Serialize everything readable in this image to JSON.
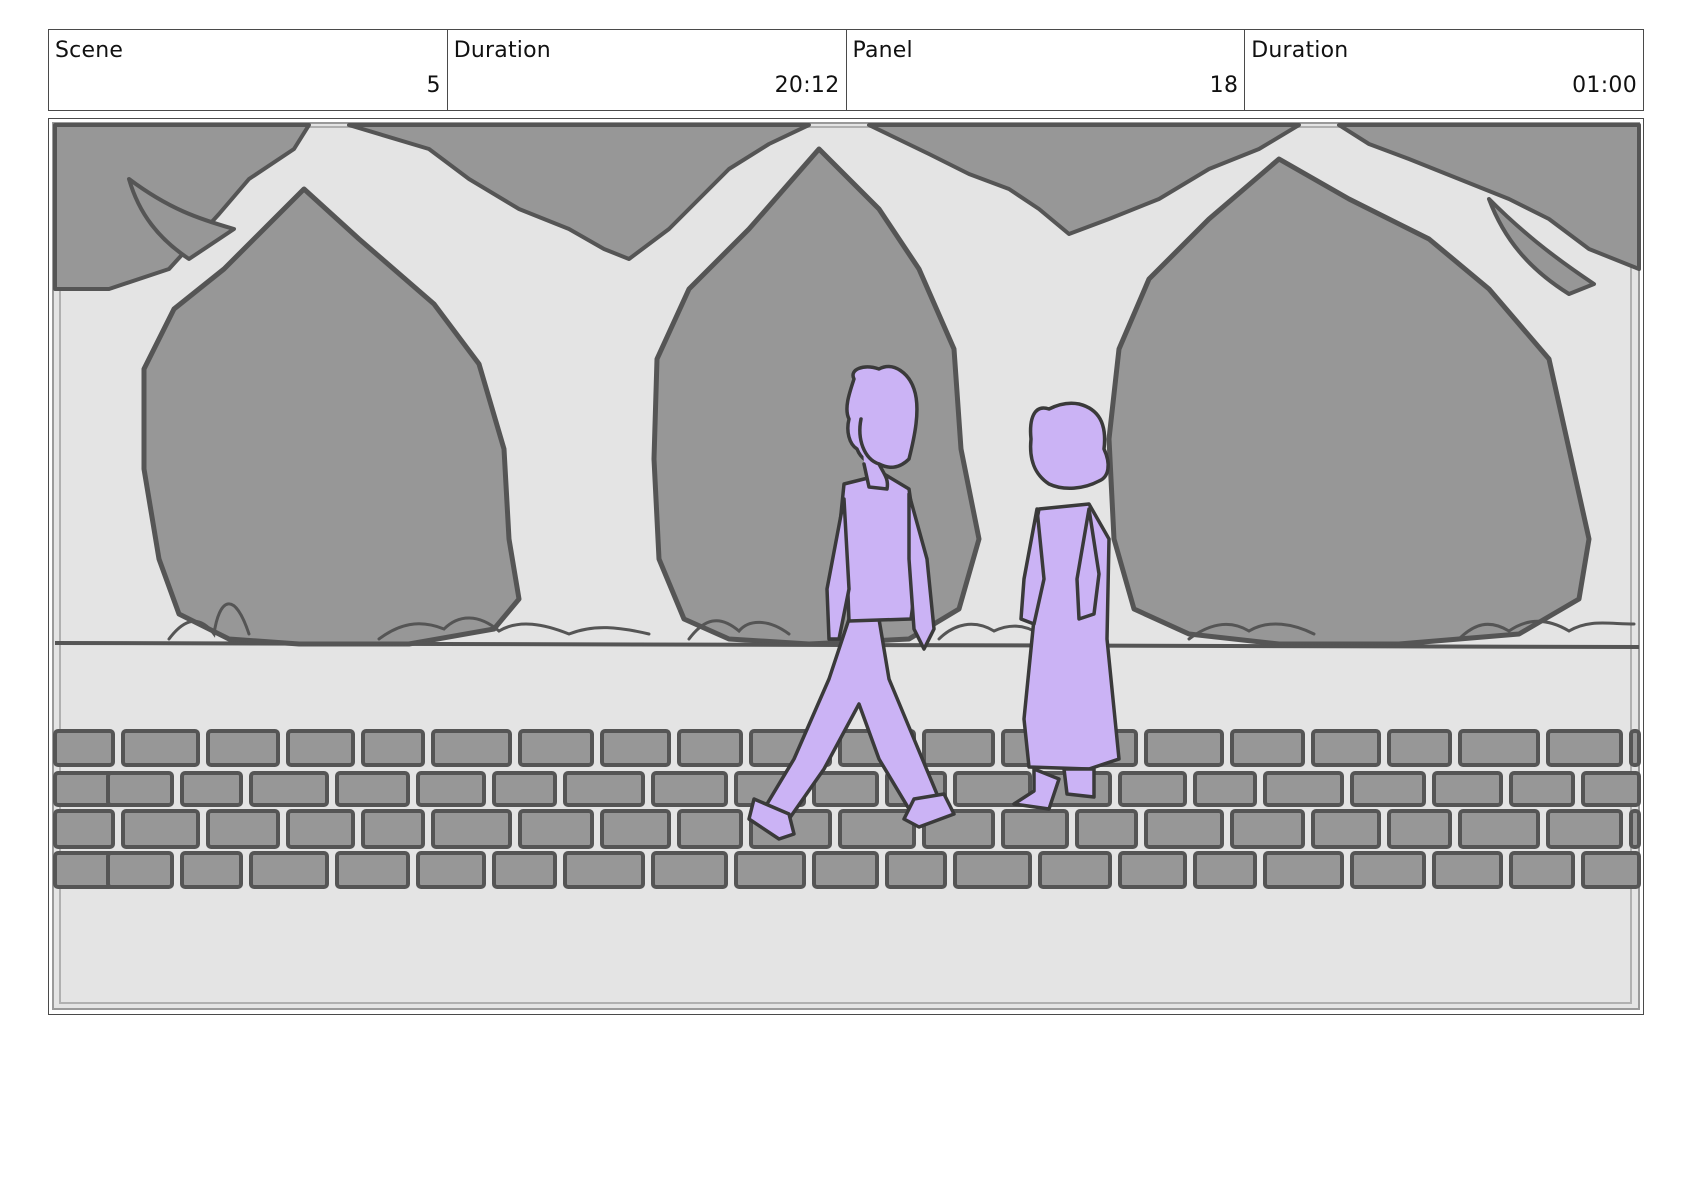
{
  "header": {
    "cells": [
      {
        "label": "Scene",
        "value": "5"
      },
      {
        "label": "Duration",
        "value": "20:12"
      },
      {
        "label": "Panel",
        "value": "18"
      },
      {
        "label": "Duration",
        "value": "01:00"
      }
    ]
  },
  "panel": {
    "illustration": "storyboard-drawing",
    "colors": {
      "background": "#e4e4e4",
      "foliage": "#979797",
      "outline": "#555555",
      "characters": "#cbb3f5",
      "character_outline": "#3a3a3a"
    }
  }
}
